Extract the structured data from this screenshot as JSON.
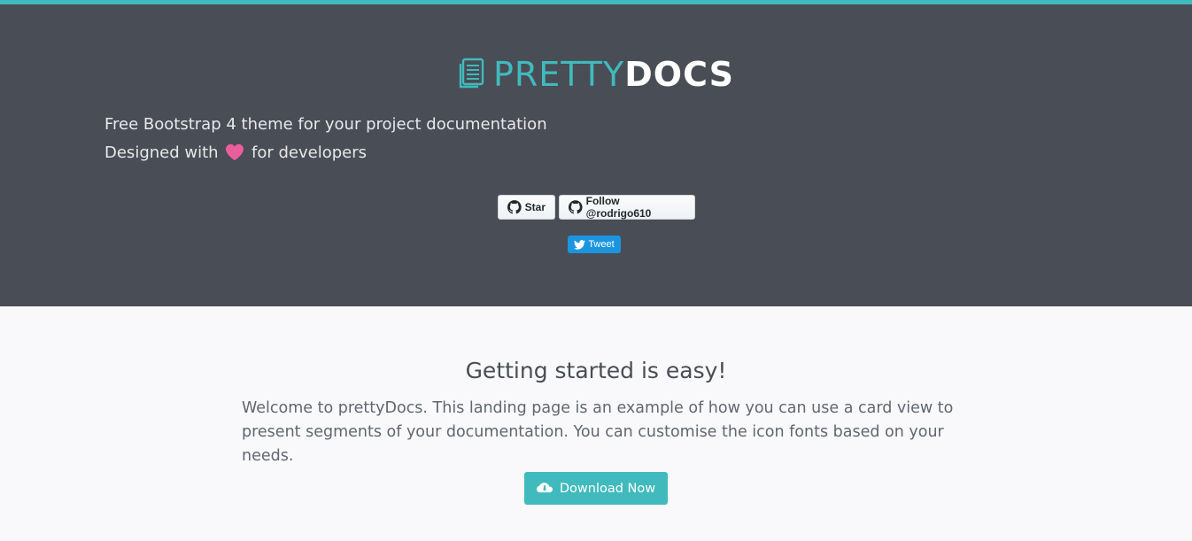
{
  "brand": {
    "pretty": "PRETTY",
    "docs": "DOCS"
  },
  "tagline": {
    "line1": "Free Bootstrap 4 theme for your project documentation",
    "line2_prefix": "Designed with",
    "line2_suffix": "for developers"
  },
  "social": {
    "github_star_label": "Star",
    "github_follow_label": "Follow @rodrigo610",
    "tweet_label": "Tweet"
  },
  "main": {
    "title": "Getting started is easy!",
    "intro": "Welcome to prettyDocs. This landing page is an example of how you can use a card view to present segments of your documentation. You can customise the icon fonts based on your needs.",
    "download_label": "Download Now"
  },
  "colors": {
    "accent": "#40babd",
    "header_bg": "#494d55",
    "body_bg": "#f9f9fb",
    "heart": "#ea5e9d",
    "twitter": "#1b95e0"
  },
  "icons": [
    "document-icon",
    "heart-icon",
    "github-icon",
    "twitter-bird-icon",
    "cloud-download-icon"
  ]
}
